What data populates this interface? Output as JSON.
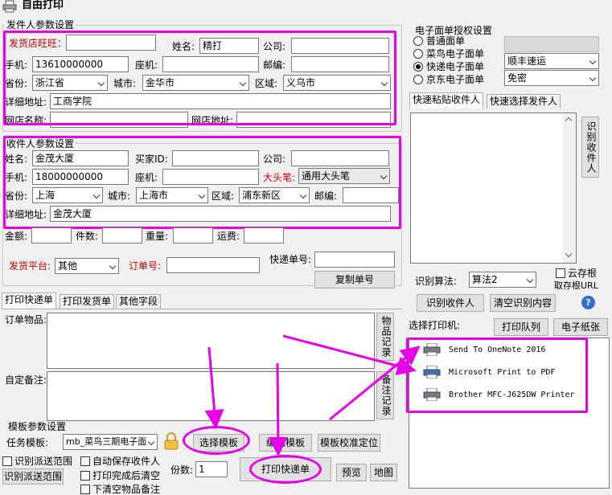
{
  "window": {
    "title": "自由打印"
  },
  "sender": {
    "group_title": "发件人参数设置",
    "shop_label": "发货店旺旺：",
    "shop_value": "",
    "name_label": "姓名:",
    "name_value": "精打",
    "company_label": "公司:",
    "company_value": "",
    "phone_label": "手机:",
    "phone_value": "13610000000",
    "tel_label": "座机:",
    "tel_value": "",
    "zip_label": "邮编:",
    "zip_value": "",
    "province_label": "省份:",
    "province_value": "浙江省",
    "city_label": "城市:",
    "city_value": "金华市",
    "district_label": "区域:",
    "district_value": "义乌市",
    "address_label": "详细地址:",
    "address_value": "工商学院",
    "shopname_label": "网店名称:",
    "shopname_value": "",
    "shopurl_label": "网店地址:",
    "shopurl_value": ""
  },
  "receiver": {
    "group_title": "收件人参数设置",
    "name_label": "姓名:",
    "name_value": "金茂大厦",
    "buyer_label": "买家ID:",
    "buyer_value": "",
    "company_label": "公司:",
    "company_value": "",
    "phone_label": "手机:",
    "phone_value": "18000000000",
    "tel_label": "座机:",
    "tel_value": "",
    "bigpen_label": "大头笔:",
    "bigpen_value": "通用大头笔",
    "province_label": "省份:",
    "province_value": "上海",
    "city_label": "城市:",
    "city_value": "上海市",
    "district_label": "区域:",
    "district_value": "浦东新区",
    "zip_label": "邮编:",
    "zip_value": "",
    "address_label": "详细地址:",
    "address_value": "金茂大厦"
  },
  "misc": {
    "amount_label": "金额:",
    "count_label": "件数:",
    "weight_label": "重量:",
    "freight_label": "运费:",
    "platform_label": "发货平台:",
    "platform_value": "其他",
    "order_label": "订单号:",
    "express_no_label": "快递单号:",
    "copy_button": "复制单号"
  },
  "tabs": [
    "打印快递单",
    "打印发货单",
    "其他字段"
  ],
  "print_tab": {
    "items_label": "订单物品:",
    "items_button": "物品记录",
    "notes_label": "自定备注:",
    "notes_button": "备注记录"
  },
  "template": {
    "group_title": "模板参数设置",
    "task_label": "任务模板:",
    "task_value": "mb_菜鸟三期电子面",
    "select_button": "选择模板",
    "edit_button": "编辑模板",
    "calibrate_button": "模板校准定位"
  },
  "bottom": {
    "detect_range": "识别派送范围",
    "detect_range_button": "识别派送范围",
    "auto_save": "自动保存收件人",
    "clear_after": "打印完成后清空",
    "clear_items": "下清空物品备注",
    "copies_label": "份数:",
    "copies_value": "1",
    "print_button": "打印快递单",
    "preview_button": "预览",
    "map_button": "地图"
  },
  "eorder": {
    "group_title": "电子面单授权设置",
    "options": [
      "普通面单",
      "菜鸟电子面单",
      "快递电子面单",
      "京东电子面单"
    ],
    "selected_index": 2,
    "courier_value": "顺丰速运",
    "auth_value": "免密"
  },
  "right_tabs": [
    "快速粘贴收件人",
    "快速选择发件人"
  ],
  "recognize": {
    "recognize_button": "识别收件人",
    "algo_label": "识别算法:",
    "algo_value": "算法2",
    "cloud_save": "云存根",
    "cloud_take": "取存根URL",
    "recognize_receiver_button": "识别收件人",
    "clear_button": "清空识别内容",
    "help_icon": "?"
  },
  "printers": {
    "label": "选择打印机:",
    "queue_button": "打印队列",
    "paper_button": "电子纸张",
    "list": [
      "Send To OneNote 2016",
      "Microsoft Print to PDF",
      "Brother MFC-J625DW Printer"
    ]
  },
  "colors": {
    "highlight": "#e600e6",
    "label_red": "#c00000"
  }
}
